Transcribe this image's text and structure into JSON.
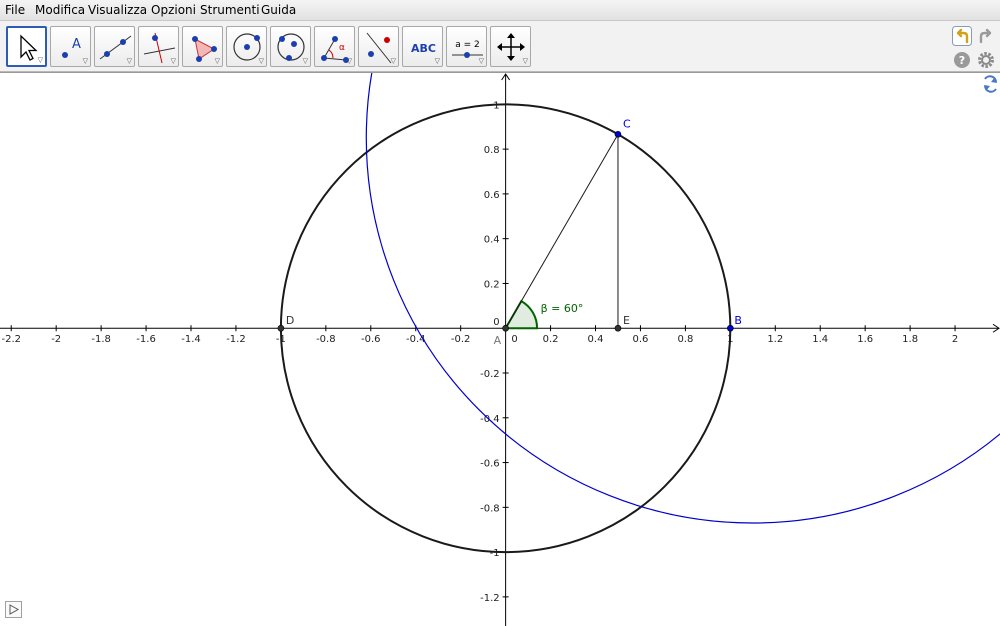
{
  "menubar": {
    "items": [
      {
        "name": "menu-file",
        "label": "File"
      },
      {
        "name": "menu-modifica",
        "label": "Modifica"
      },
      {
        "name": "menu-visualizza",
        "label": "Visualizza"
      },
      {
        "name": "menu-opzioni",
        "label": "Opzioni"
      },
      {
        "name": "menu-strumenti",
        "label": "Strumenti"
      },
      {
        "name": "menu-guida",
        "label": "Guida"
      }
    ]
  },
  "toolbar": {
    "tools": [
      {
        "name": "tool-move",
        "icon": "move-arrow-icon",
        "selected": true
      },
      {
        "name": "tool-new-point",
        "icon": "new-point-icon",
        "label": "A"
      },
      {
        "name": "tool-line",
        "icon": "line-through-points-icon"
      },
      {
        "name": "tool-perpendicular",
        "icon": "perpendicular-line-icon"
      },
      {
        "name": "tool-polygon",
        "icon": "polygon-icon"
      },
      {
        "name": "tool-circle",
        "icon": "circle-center-point-icon"
      },
      {
        "name": "tool-circle-three-points",
        "icon": "circle-three-points-icon"
      },
      {
        "name": "tool-angle",
        "icon": "angle-icon",
        "label": "α"
      },
      {
        "name": "tool-reflect",
        "icon": "reflect-about-line-icon"
      },
      {
        "name": "tool-text",
        "icon": "text-icon",
        "label": "ABC"
      },
      {
        "name": "tool-slider",
        "icon": "slider-icon",
        "label": "a = 2"
      },
      {
        "name": "tool-move-view",
        "icon": "move-graphics-view-icon"
      }
    ],
    "right_buttons": [
      {
        "name": "undo-button",
        "icon": "undo-icon"
      },
      {
        "name": "redo-button",
        "icon": "redo-icon"
      },
      {
        "name": "help-button",
        "icon": "help-icon"
      },
      {
        "name": "settings-button",
        "icon": "gear-icon"
      }
    ]
  },
  "graphics": {
    "x_range": [
      -2.25,
      2.2
    ],
    "y_range": [
      -1.33,
      1.14
    ],
    "x_ticks": [
      {
        "v": -2.2,
        "t": "-2.2"
      },
      {
        "v": -2,
        "t": "-2"
      },
      {
        "v": -1.8,
        "t": "-1.8"
      },
      {
        "v": -1.6,
        "t": "-1.6"
      },
      {
        "v": -1.4,
        "t": "-1.4"
      },
      {
        "v": -1.2,
        "t": "-1.2"
      },
      {
        "v": -1,
        "t": "-1"
      },
      {
        "v": -0.8,
        "t": "-0.8"
      },
      {
        "v": -0.6,
        "t": "-0.6"
      },
      {
        "v": -0.4,
        "t": "-0.4"
      },
      {
        "v": -0.2,
        "t": "-0.2"
      },
      {
        "v": 0,
        "t": "0"
      },
      {
        "v": 0.2,
        "t": "0.2"
      },
      {
        "v": 0.4,
        "t": "0.4"
      },
      {
        "v": 0.6,
        "t": "0.6"
      },
      {
        "v": 0.8,
        "t": "0.8"
      },
      {
        "v": 1,
        "t": "1"
      },
      {
        "v": 1.2,
        "t": "1.2"
      },
      {
        "v": 1.4,
        "t": "1.4"
      },
      {
        "v": 1.6,
        "t": "1.6"
      },
      {
        "v": 1.8,
        "t": "1.8"
      },
      {
        "v": 2,
        "t": "2"
      }
    ],
    "y_ticks": [
      {
        "v": 1,
        "t": "1"
      },
      {
        "v": 0.8,
        "t": "0.8"
      },
      {
        "v": 0.6,
        "t": "0.6"
      },
      {
        "v": 0.4,
        "t": "0.4"
      },
      {
        "v": 0.2,
        "t": "0.2"
      },
      {
        "v": 0,
        "t": "0"
      },
      {
        "v": -0.2,
        "t": "-0.2"
      },
      {
        "v": -0.4,
        "t": "-0.4"
      },
      {
        "v": -0.6,
        "t": "-0.6"
      },
      {
        "v": -0.8,
        "t": "-0.8"
      },
      {
        "v": -1,
        "t": "-1"
      },
      {
        "v": -1.2,
        "t": "-1.2"
      }
    ],
    "circles": [
      {
        "name": "unit-circle",
        "cx": 0,
        "cy": 0,
        "r": 1,
        "color": "#1a1a1a"
      },
      {
        "name": "blue-circle",
        "cx": 1.1,
        "cy": 0.85,
        "r": 1.72,
        "color": "#0000cc"
      }
    ],
    "points": [
      {
        "name": "point-A",
        "label": "A",
        "x": 0,
        "y": 0,
        "color": "#333333"
      },
      {
        "name": "point-B",
        "label": "B",
        "x": 1,
        "y": 0,
        "color": "#0000cc"
      },
      {
        "name": "point-C",
        "label": "C",
        "x": 0.5,
        "y": 0.866,
        "color": "#0000cc"
      },
      {
        "name": "point-D",
        "label": "D",
        "x": -1,
        "y": 0,
        "color": "#333333"
      },
      {
        "name": "point-E",
        "label": "E",
        "x": 0.5,
        "y": 0,
        "color": "#333333"
      }
    ],
    "segments": [
      {
        "name": "segment-AC",
        "from": [
          0,
          0
        ],
        "to": [
          0.5,
          0.866
        ]
      },
      {
        "name": "segment-CE",
        "from": [
          0.5,
          0.866
        ],
        "to": [
          0.5,
          0
        ]
      }
    ],
    "angle": {
      "name": "angle-beta",
      "label": "β = 60°",
      "degrees": 60,
      "radius": 0.14,
      "color": "#006400"
    }
  }
}
